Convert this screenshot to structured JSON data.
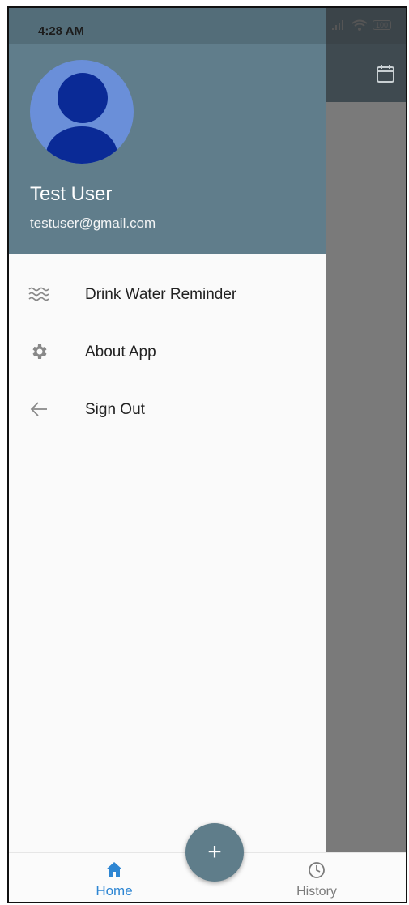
{
  "status_bar": {
    "time": "4:28 AM",
    "battery": "100"
  },
  "drawer": {
    "user_name": "Test User",
    "user_email": "testuser@gmail.com",
    "menu_items": [
      {
        "label": "Drink Water Reminder",
        "icon": "waves-icon"
      },
      {
        "label": "About App",
        "icon": "gear-icon"
      },
      {
        "label": "Sign Out",
        "icon": "arrow-left-icon"
      }
    ]
  },
  "bottom_nav": {
    "home_label": "Home",
    "history_label": "History",
    "active_tab": "Home",
    "active_color": "#2e86d3"
  },
  "fab": {
    "symbol": "+"
  },
  "colors": {
    "header": "#607d8b",
    "avatar_bg": "#6a8fd9",
    "avatar_fg": "#0a2a96",
    "fab": "#5f7d8a"
  }
}
